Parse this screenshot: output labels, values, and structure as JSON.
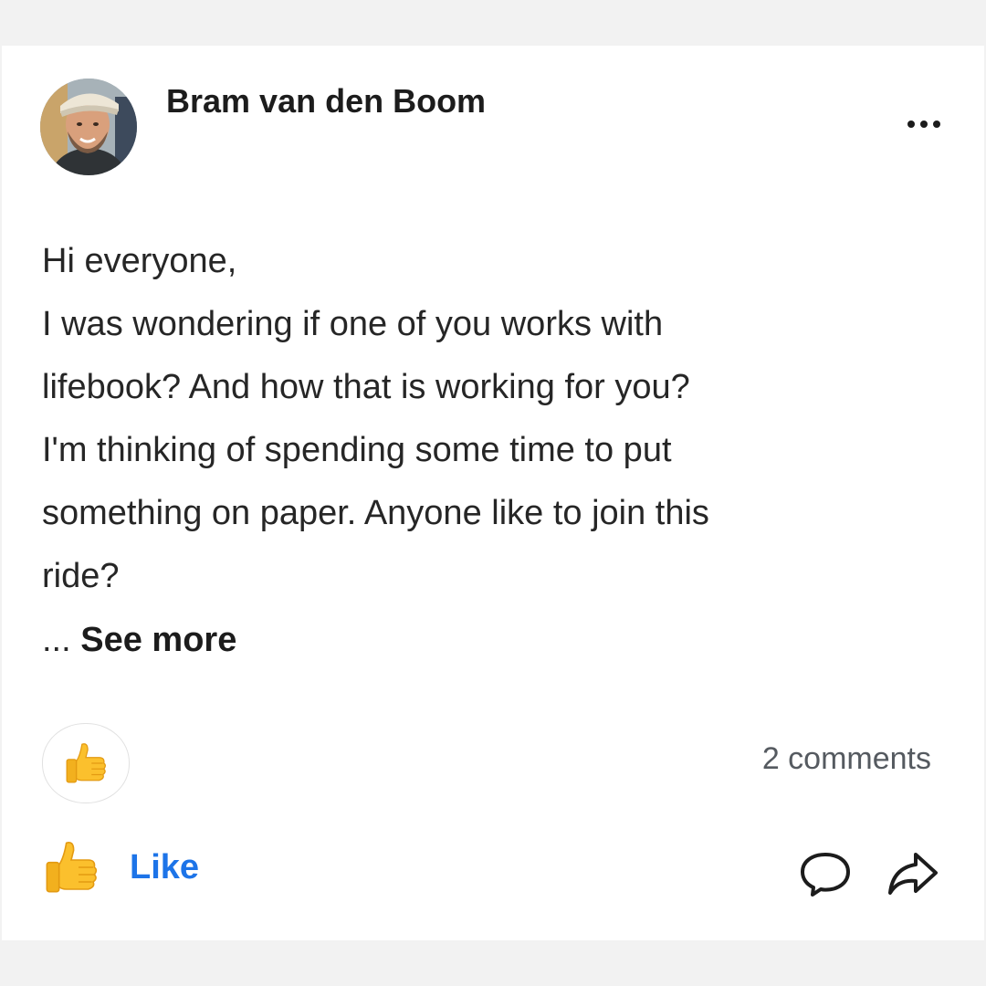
{
  "post": {
    "author": "Bram van den Boom",
    "body_lines": [
      "Hi everyone,",
      "I was wondering if one of you works with",
      "lifebook? And how that is working for you?",
      "I'm thinking of spending some time to put",
      "something on paper. Anyone like to join this",
      "ride?"
    ],
    "see_more_ellipsis": "...",
    "see_more_label": "See more"
  },
  "reactions": {
    "icon": "thumbs-up-icon",
    "comments_label": "2 comments"
  },
  "actions": {
    "like_label": "Like",
    "like_icon": "thumbs-up-icon",
    "comment_icon": "speech-bubble-icon",
    "share_icon": "share-arrow-icon"
  },
  "colors": {
    "like_blue": "#1d74e8",
    "thumb_yellow": "#fbc02d"
  }
}
